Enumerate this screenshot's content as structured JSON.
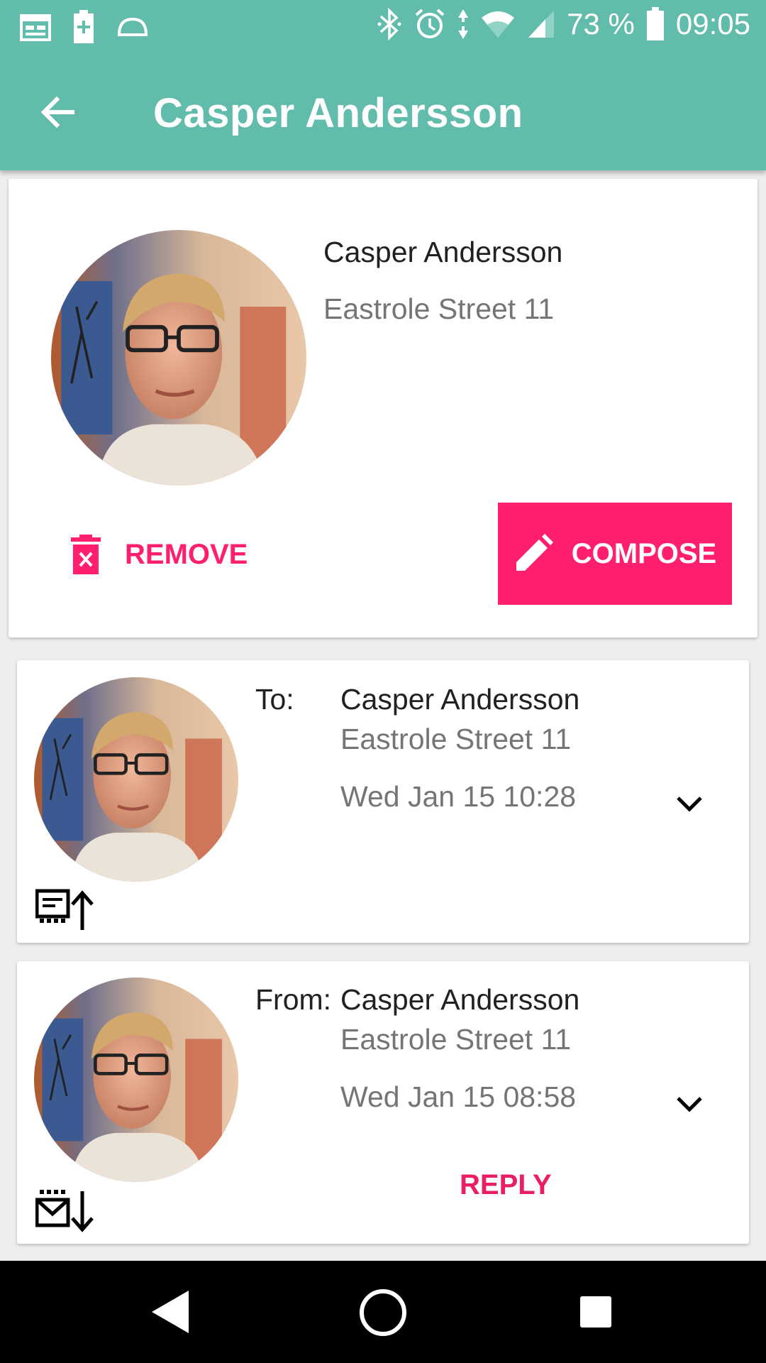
{
  "status_bar": {
    "battery_percent": "73 %",
    "time": "09:05",
    "icons": [
      "calendar-icon",
      "battery-saver-icon",
      "arc-icon",
      "bluetooth-icon",
      "alarm-icon",
      "data-arrows-icon",
      "wifi-icon",
      "signal-icon",
      "battery-icon"
    ]
  },
  "toolbar": {
    "title": "Casper Andersson",
    "back_icon": "arrow-back-icon"
  },
  "contact": {
    "name": "Casper Andersson",
    "address": "Eastrole Street 11",
    "remove_label": "REMOVE",
    "compose_label": "COMPOSE",
    "accent_color": "#ff1f6e"
  },
  "messages": [
    {
      "direction_label": "To:",
      "name": "Casper Andersson",
      "address": "Eastrole Street 11",
      "datetime": "Wed Jan 15 10:28",
      "type_icon": "sent-message-icon"
    },
    {
      "direction_label": "From:",
      "name": "Casper Andersson",
      "address": "Eastrole Street 11",
      "datetime": "Wed Jan 15 08:58",
      "type_icon": "received-mail-icon",
      "reply_label": "REPLY"
    }
  ],
  "nav_bar": {
    "icons": [
      "nav-back-icon",
      "nav-home-icon",
      "nav-recents-icon"
    ]
  }
}
